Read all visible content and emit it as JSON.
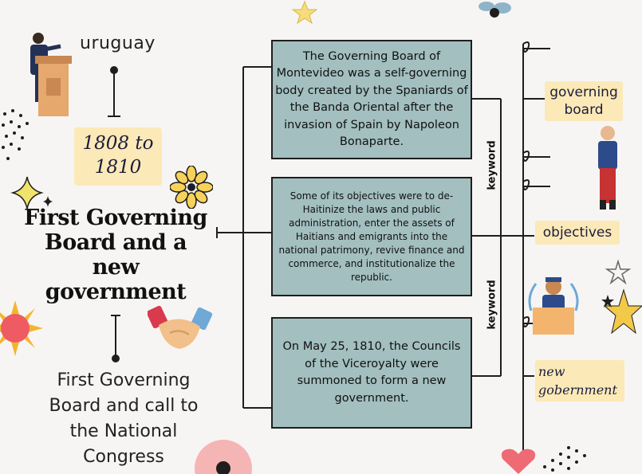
{
  "header": {
    "topic": "uruguay"
  },
  "timeline": {
    "years": "1808 to 1810"
  },
  "title": {
    "main": "First Governing Board and a new government"
  },
  "subtitle": {
    "text": "First Governing Board and call to the National Congress"
  },
  "boxes": [
    {
      "text": "The Governing Board of Montevideo was a self-governing body created by the Spaniards of the Banda Oriental after the invasion of Spain by Napoleon Bonaparte."
    },
    {
      "text": "Some of its objectives were to de-Haitinize the laws and public administration, enter the assets of Haitians and emigrants into the national patrimony, revive finance and commerce, and institutionalize the republic."
    },
    {
      "text": "On May 25, 1810, the Councils of the Viceroyalty were summoned to form a new government."
    }
  ],
  "keywords": {
    "label1": "keyword",
    "label2": "keyword"
  },
  "tags": {
    "governing_board": "governing board",
    "objectives": "objectives",
    "new_government": "new gobernment"
  },
  "colors": {
    "box": "#a3bfc0",
    "tag": "#fbe9b8",
    "line": "#1e1e1e"
  }
}
